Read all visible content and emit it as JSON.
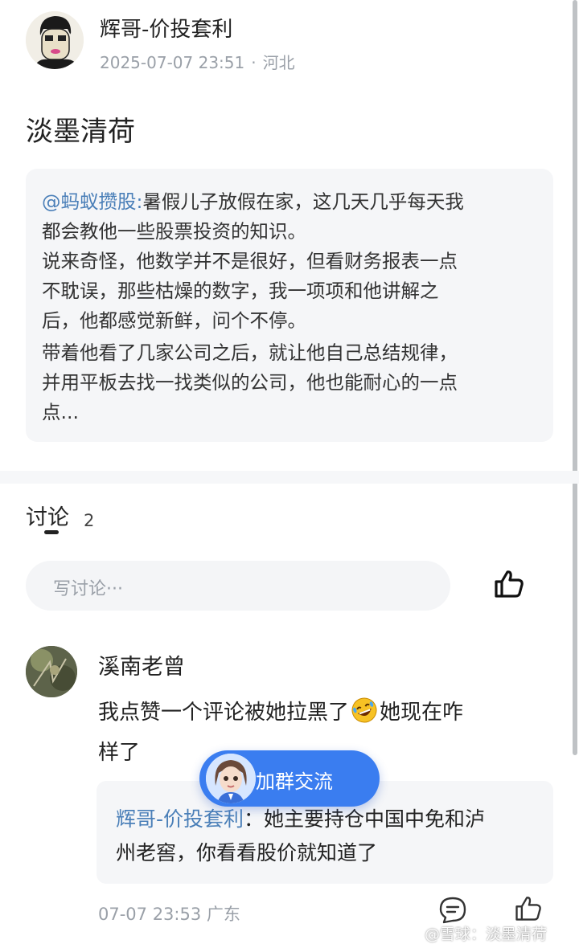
{
  "post": {
    "author": "辉哥-价投套利",
    "timestamp": "2025-07-07 23:51",
    "meta_sep": "·",
    "location": "河北",
    "title": "淡墨清荷"
  },
  "quote": {
    "mention": "@蚂蚁攒股",
    "colon": ":",
    "lines": [
      "暑假儿子放假在家，这几天几乎每天我",
      "都会教他一些股票投资的知识。",
      "说来奇怪，他数学并不是很好，但看财务报表一点",
      "不耽误，那些枯燥的数字，我一项项和他讲解之",
      "后，他都感觉新鲜，问个不停。",
      "带着他看了几家公司之后，就让他自己总结规律，",
      "并用平板去找一找类似的公司，他也能耐心的一点",
      "点..."
    ]
  },
  "discussion": {
    "tab_label": "讨论",
    "count": "2",
    "input_placeholder": "写讨论···"
  },
  "comment": {
    "name": "溪南老曾",
    "line1_a": "我点赞一个评论被她拉黑了",
    "line1_b": "她现在咋",
    "line2": "样了",
    "emoji_icon": "rofl-emoji-icon",
    "reply_author": "辉哥-价投套利",
    "reply_colon": "：",
    "reply_line1": "她主要持仓中国中免和泸",
    "reply_line2": "州老窖，你看看股价就知道了",
    "time": "07-07 23:53 广东"
  },
  "float_button": {
    "label": "加群交流"
  },
  "watermark": "@雪球：淡墨清荷",
  "colors": {
    "accent_blue": "#3a7df0",
    "mention_blue": "#4a7fb8",
    "meta_gray": "#9aa0a8",
    "card_bg": "#f5f6f8"
  }
}
